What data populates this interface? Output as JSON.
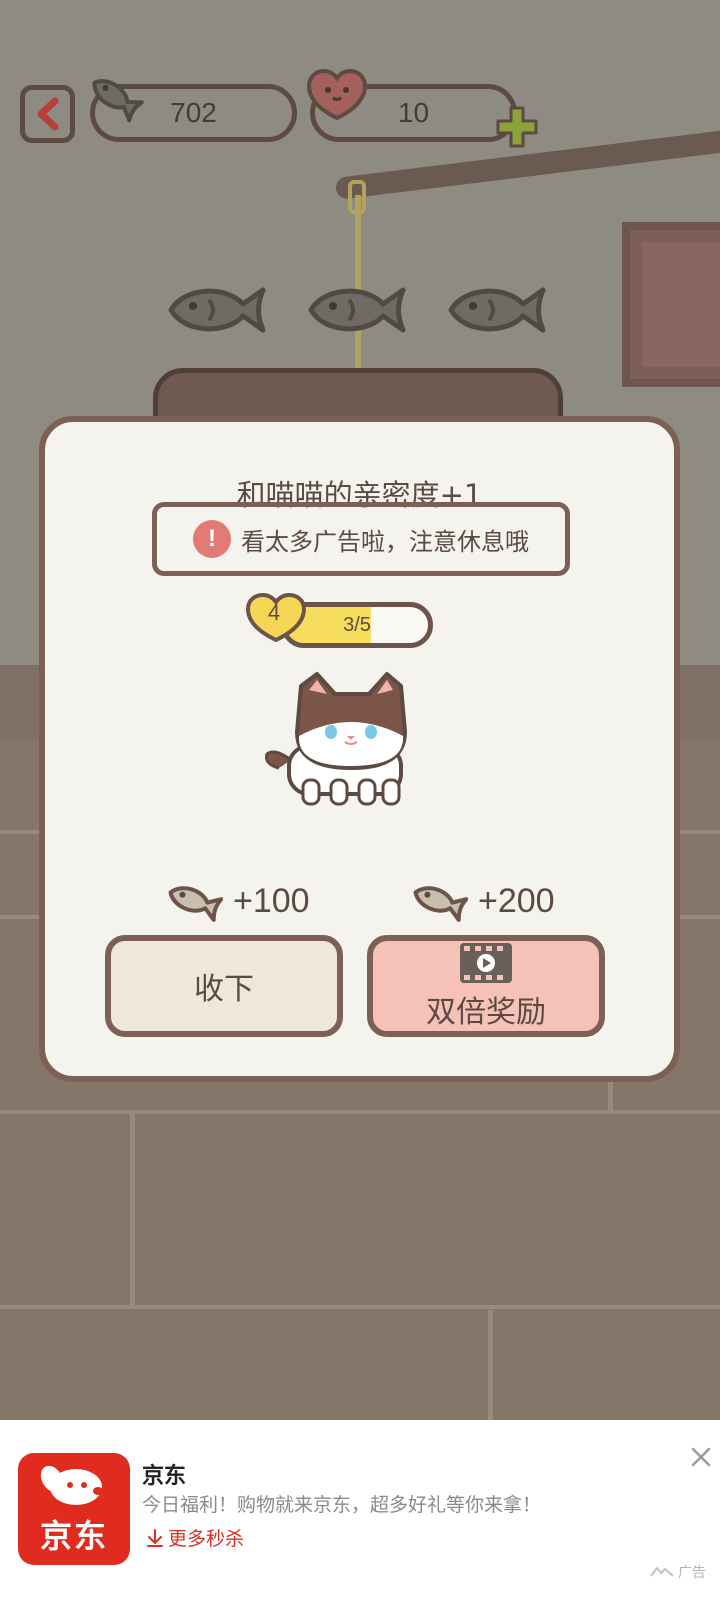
{
  "header": {
    "fish_count": "702",
    "heart_count": "10"
  },
  "dialog": {
    "title": "和喵喵的亲密度+1",
    "warning": "看太多广告啦，注意休息哦",
    "level": "4",
    "progress_text": "3/5",
    "progress_fraction": 0.6,
    "rewards": [
      "+100",
      "+200"
    ],
    "collect_label": "收下",
    "double_label": "双倍奖励"
  },
  "ad": {
    "brand": "京东",
    "logo_text": "京东",
    "description": "今日福利！购物就来京东，超多好礼等你来拿！",
    "link": "更多秒杀",
    "tag": "广告"
  },
  "colors": {
    "accent_yellow": "#f6dd5d",
    "double_button": "#f6c1b6",
    "ad_red": "#e02b1f"
  }
}
